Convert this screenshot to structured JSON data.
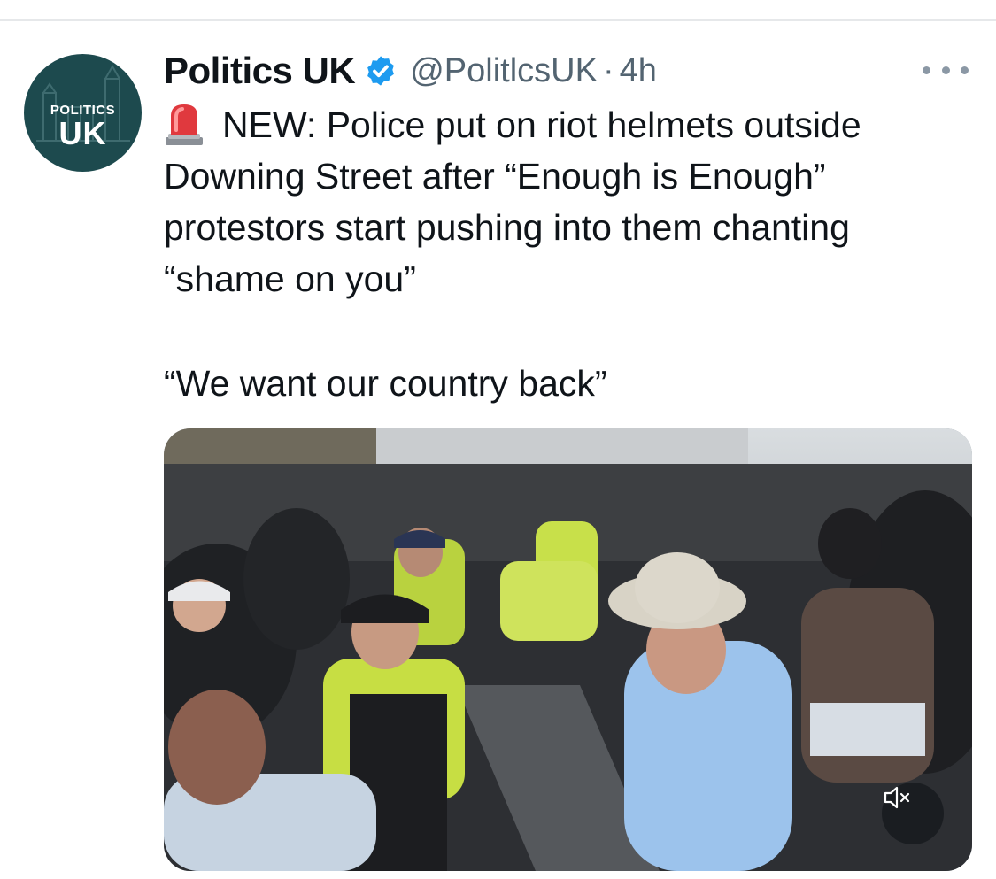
{
  "tweet": {
    "author": {
      "display_name": "Politics UK",
      "handle": "@PolitlcsUK",
      "separator": "·",
      "time": "4h",
      "verified": true,
      "avatar": {
        "line1": "POLITICS",
        "line2": "UK"
      }
    },
    "text_lines": [
      "NEW: Police put on riot helmets outside",
      "Downing Street after “Enough is Enough”",
      "protestors start pushing into them chanting",
      "“shame on you”"
    ],
    "quote": "“We want our country back”",
    "leading_emoji": "siren-icon",
    "media": {
      "type": "video",
      "muted": true
    },
    "more_icon": "more-options-icon"
  },
  "colors": {
    "verified_blue": "#1d9bf0",
    "secondary_text": "#536471",
    "avatar_bg": "#1d4a4e",
    "hi_vis_yellow": "#c8e04a"
  }
}
